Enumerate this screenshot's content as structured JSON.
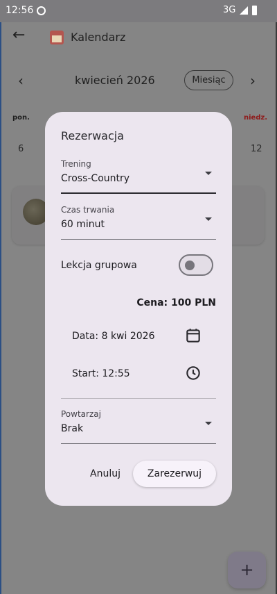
{
  "status_bar": {
    "time": "12:56",
    "network": "3G"
  },
  "app_bar": {
    "title": "Kalendarz"
  },
  "calendar": {
    "month": "kwiecień 2026",
    "view_button": "Miesiąc",
    "weekday_first": "pon.",
    "weekday_last": "niedz.",
    "day_first": "6",
    "day_last": "12"
  },
  "dialog": {
    "title": "Rezerwacja",
    "training": {
      "label": "Trening",
      "value": "Cross-Country"
    },
    "duration": {
      "label": "Czas trwania",
      "value": "60 minut"
    },
    "group_lesson": {
      "label": "Lekcja grupowa",
      "enabled": false
    },
    "price": "Cena: 100 PLN",
    "date": "Data: 8 kwi 2026",
    "start": "Start: 12:55",
    "repeat": {
      "label": "Powtarzaj",
      "value": "Brak"
    },
    "cancel_label": "Anuluj",
    "book_label": "Zarezerwuj"
  },
  "fab": {
    "symbol": "+"
  },
  "icons": {
    "back": "arrow-left-icon",
    "app": "calendar-app-icon",
    "prev": "chevron-left-icon",
    "next": "chevron-right-icon",
    "date": "calendar-icon",
    "time": "clock-icon",
    "dropdown": "dropdown-arrow-icon",
    "add": "plus-icon"
  },
  "colors": {
    "dialog_bg": "#ece6ef",
    "scrim": "#858585",
    "weekend": "#8f1a1a"
  }
}
